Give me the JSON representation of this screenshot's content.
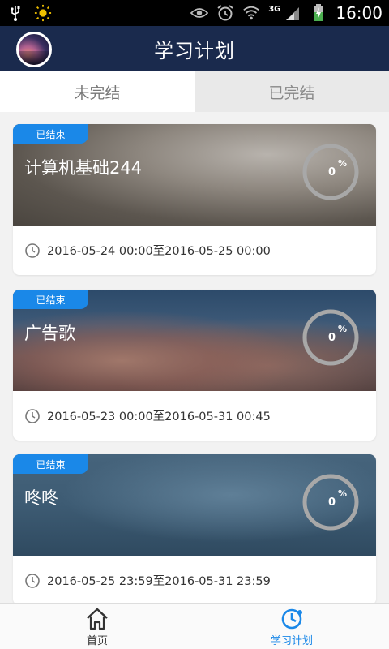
{
  "status_bar": {
    "time": "16:00",
    "network": "3G"
  },
  "header": {
    "title": "学习计划"
  },
  "tabs": [
    {
      "label": "未完结",
      "active": true
    },
    {
      "label": "已完结",
      "active": false
    }
  ],
  "plans": [
    {
      "badge": "已结束",
      "title": "计算机基础244",
      "progress": "0",
      "percent_sign": "%",
      "time_range": "2016-05-24 00:00至2016-05-25 00:00"
    },
    {
      "badge": "已结束",
      "title": "广告歌",
      "progress": "0",
      "percent_sign": "%",
      "time_range": "2016-05-23 00:00至2016-05-31 00:45"
    },
    {
      "badge": "已结束",
      "title": "咚咚",
      "progress": "0",
      "percent_sign": "%",
      "time_range": "2016-05-25 23:59至2016-05-31 23:59"
    }
  ],
  "bottom_nav": [
    {
      "label": "首页",
      "icon": "home-icon",
      "active": false
    },
    {
      "label": "学习计划",
      "icon": "clock-icon",
      "active": true
    }
  ],
  "colors": {
    "header_bg": "#1a2a4d",
    "accent": "#1a88e8",
    "status_bar_bg": "#000000"
  }
}
